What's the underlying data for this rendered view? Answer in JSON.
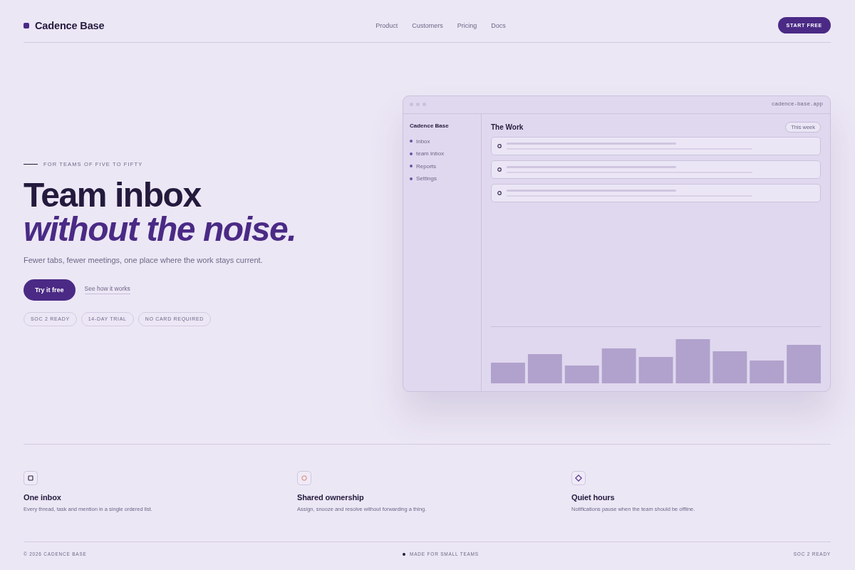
{
  "nav": {
    "brand": "Cadence Base",
    "links": [
      {
        "label": "Product"
      },
      {
        "label": "Customers"
      },
      {
        "label": "Pricing"
      },
      {
        "label": "Docs"
      }
    ],
    "cta": "START FREE"
  },
  "hero": {
    "eyebrow": "FOR TEAMS OF FIVE TO FIFTY",
    "headline": "Team inbox",
    "headline_accent": "without the noise.",
    "subtitle": "Fewer tabs, fewer meetings, one place where the work stays current.",
    "primary_button": "Try it free",
    "secondary_link": "See how it works",
    "badges": [
      "SOC 2 READY",
      "14-DAY TRIAL",
      "NO CARD REQUIRED"
    ]
  },
  "app_preview": {
    "url": "cadence-base.app",
    "sidebar": {
      "brand": "Cadence Base",
      "items": [
        {
          "label": "Inbox"
        },
        {
          "label": "team inbox"
        },
        {
          "label": "Reports"
        },
        {
          "label": "Settings"
        }
      ]
    },
    "main": {
      "title": "The Work",
      "filter": "This week",
      "rows": [
        {
          "kind": "skeleton"
        },
        {
          "kind": "skeleton"
        },
        {
          "kind": "skeleton"
        }
      ]
    }
  },
  "features": [
    {
      "title": "One inbox",
      "description": "Every thread, task and mention in a single ordered list."
    },
    {
      "title": "Shared ownership",
      "description": "Assign, snooze and resolve without forwarding a thing."
    },
    {
      "title": "Quiet hours",
      "description": "Notifications pause when the team should be offline."
    }
  ],
  "footer": {
    "copyright": "© 2026 CADENCE BASE",
    "tagline": "MADE FOR SMALL TEAMS",
    "compliance": "SOC 2 READY"
  }
}
